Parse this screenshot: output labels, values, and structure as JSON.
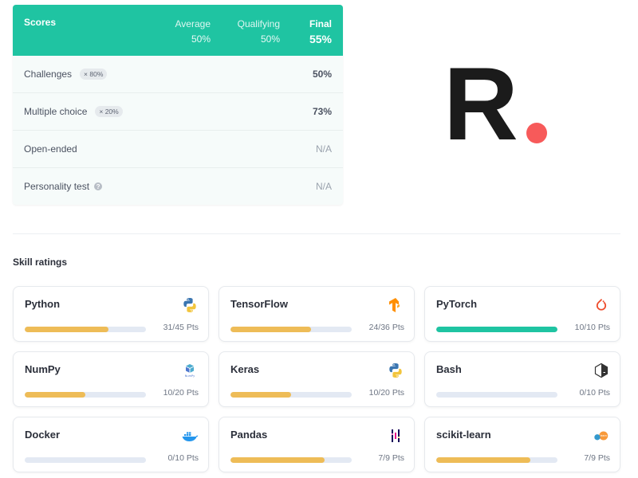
{
  "scores": {
    "title": "Scores",
    "columns": [
      {
        "label": "Average",
        "value": "50%"
      },
      {
        "label": "Qualifying",
        "value": "50%"
      },
      {
        "label": "Final",
        "value": "55%"
      }
    ],
    "rows": [
      {
        "label": "Challenges",
        "weight": "× 80%",
        "value": "50%"
      },
      {
        "label": "Multiple choice",
        "weight": "× 20%",
        "value": "73%"
      },
      {
        "label": "Open-ended",
        "value": "N/A"
      },
      {
        "label": "Personality test",
        "value": "N/A"
      }
    ]
  },
  "logo": {
    "letter": "R",
    "dot_color": "#f75a5a"
  },
  "skills": {
    "title": "Skill ratings",
    "items": [
      {
        "name": "Python",
        "points": "31/45 Pts",
        "progress": 0.689,
        "icon": "python-icon"
      },
      {
        "name": "TensorFlow",
        "points": "24/36 Pts",
        "progress": 0.667,
        "icon": "tensorflow-icon"
      },
      {
        "name": "PyTorch",
        "points": "10/10 Pts",
        "progress": 1.0,
        "icon": "pytorch-icon"
      },
      {
        "name": "NumPy",
        "points": "10/20 Pts",
        "progress": 0.5,
        "icon": "numpy-icon"
      },
      {
        "name": "Keras",
        "points": "10/20 Pts",
        "progress": 0.5,
        "icon": "python-icon"
      },
      {
        "name": "Bash",
        "points": "0/10 Pts",
        "progress": 0.0,
        "icon": "bash-icon"
      },
      {
        "name": "Docker",
        "points": "0/10 Pts",
        "progress": 0.0,
        "icon": "docker-icon"
      },
      {
        "name": "Pandas",
        "points": "7/9 Pts",
        "progress": 0.778,
        "icon": "pandas-icon"
      },
      {
        "name": "scikit-learn",
        "points": "7/9 Pts",
        "progress": 0.778,
        "icon": "scikit-learn-icon"
      }
    ]
  },
  "colors": {
    "accent": "#1fc4a2",
    "progress": "#eebc57",
    "complete": "#1fc4a2",
    "track": "#e3e9f3"
  }
}
